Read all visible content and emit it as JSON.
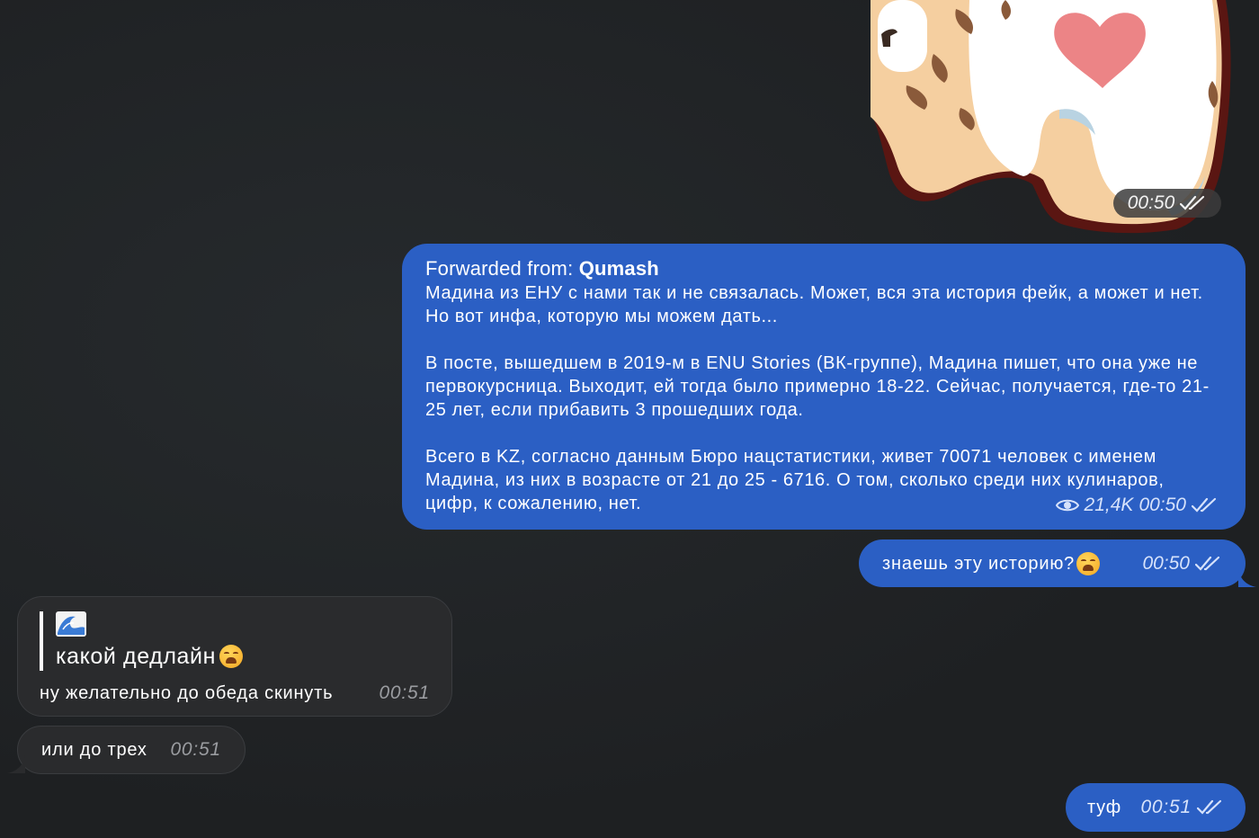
{
  "sticker": {
    "time": "00:50",
    "description_icon": "heart-cat-sticker"
  },
  "forwarded": {
    "label": "Forwarded from:",
    "source": "Qumash",
    "paragraphs": [
      "Мадина из ЕНУ с нами так и не связалась. Может, вся эта история фейк, а может и нет. Но вот инфа, которую мы можем дать...",
      "В посте, вышедшем в 2019-м в ENU Stories (ВК-группе), Мадина пишет, что она уже не первокурсница. Выходит, ей тогда было примерно 18-22. Сейчас, получается, где-то 21-25 лет, если прибавить 3 прошедших года.",
      "Всего в KZ, согласно данным Бюро нацстатистики, живет 70071 человек с именем Мадина, из них в возрасте от 21 до 25 - 6716. О том, сколько среди них кулинаров, цифр, к сожалению, нет."
    ],
    "views": "21,4K",
    "time": "00:50"
  },
  "question": {
    "text": "знаешь эту историю?",
    "time": "00:50"
  },
  "reply": {
    "quote_emoji": "🌊",
    "quote_text": "какой дедлайн",
    "text": "ну желательно до обеда скинуть",
    "time": "00:51"
  },
  "incoming2": {
    "text": "или до трех",
    "time": "00:51"
  },
  "outgoing_last": {
    "text": "туф",
    "time": "00:51"
  },
  "colors": {
    "background": "#1f2123",
    "outgoing_bubble": "#2b5fc4",
    "incoming_bubble": "#2a2b2d"
  }
}
